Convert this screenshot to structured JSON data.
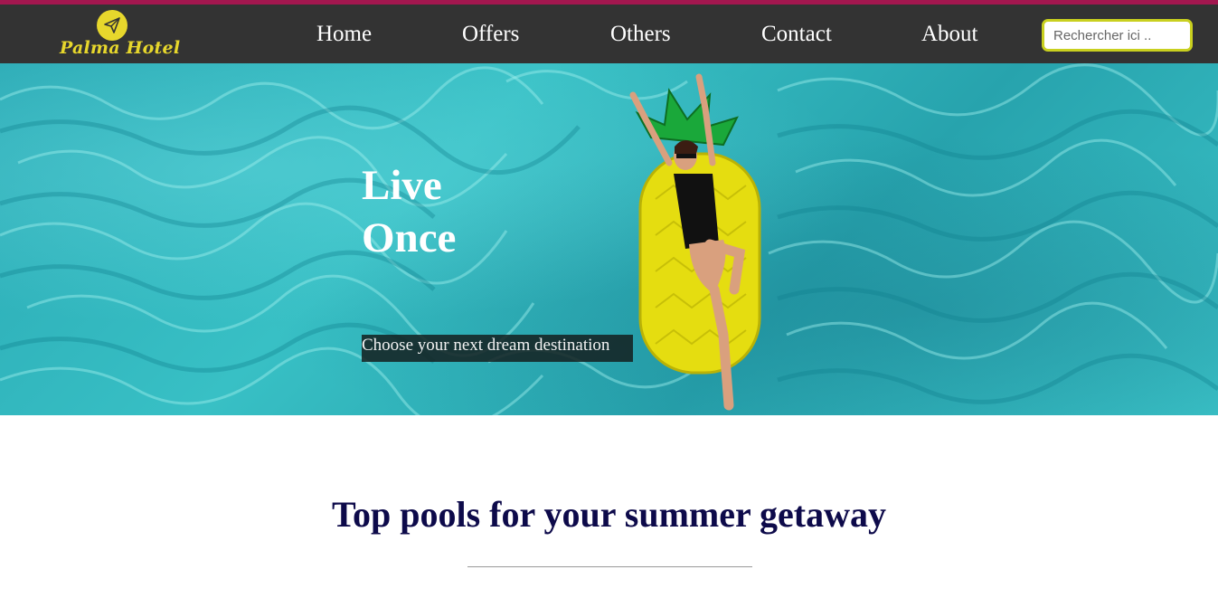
{
  "brand": {
    "name": "Palma Hotel",
    "logo_icon": "paper-plane-icon",
    "accent_color": "#e7d72c",
    "top_strip_color": "#a3174f",
    "navbar_color": "#333333"
  },
  "nav": {
    "items": [
      {
        "label": "Home"
      },
      {
        "label": "Offers"
      },
      {
        "label": "Others"
      },
      {
        "label": "Contact"
      },
      {
        "label": "About"
      }
    ]
  },
  "search": {
    "placeholder": "Rechercher ici ..",
    "value": "",
    "border_color": "#c9d01f"
  },
  "hero": {
    "title_line1": "Live",
    "title_line2": "Once",
    "subtitle": "Choose your next dream destination",
    "image": "pool-with-pineapple-float"
  },
  "section": {
    "title": "Top pools for your summer getaway",
    "title_color": "#0d0a4a"
  }
}
